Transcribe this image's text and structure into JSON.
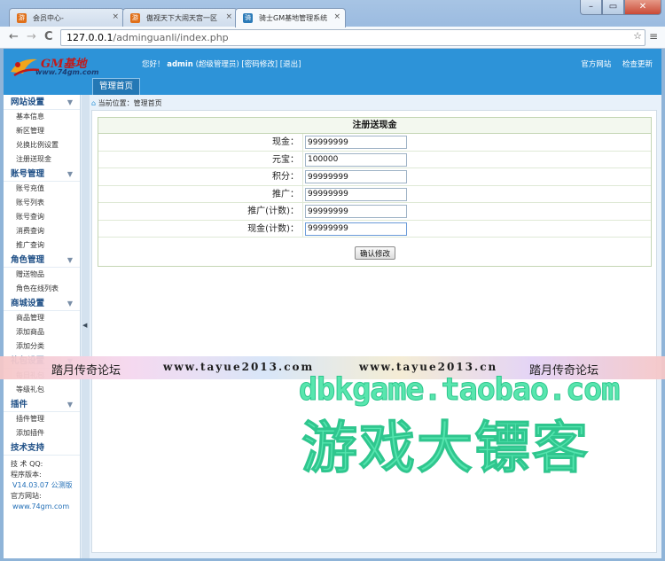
{
  "browser": {
    "tabs": [
      {
        "label": "会员中心-",
        "favicon": "游"
      },
      {
        "label": "傲视天下大闹天宫一区",
        "favicon": "游"
      },
      {
        "label": "骑士GM基地管理系统",
        "favicon": "骑"
      }
    ],
    "close_glyph": "×",
    "url_host": "127.0.0.1",
    "url_path": "/adminguanli/index.php",
    "nav": {
      "back": "←",
      "forward": "→",
      "reload": "C"
    },
    "window_buttons": {
      "minimize": "–",
      "maximize": "▭",
      "close": "✕"
    },
    "extra_icons": "☆",
    "menu": "≡"
  },
  "header": {
    "logo_name": "GM基地",
    "logo_url": "www.74gm.com",
    "greeting": "您好！",
    "username": "admin",
    "role": "(超级管理员)",
    "change_pw": "[密码修改]",
    "logout": "[退出]",
    "link_official": "官方网站",
    "link_check_update": "检查更新",
    "home_tab": "管理首页",
    "accent": "#2d93d8"
  },
  "breadcrumb": {
    "label": "当前位置：管理首页"
  },
  "sidebar": {
    "sections": [
      {
        "title": "网站设置",
        "items": [
          "基本信息",
          "新区管理",
          "兑换比例设置",
          "注册送现金"
        ]
      },
      {
        "title": "账号管理",
        "items": [
          "账号充值",
          "账号列表",
          "账号查询",
          "消费查询",
          "推广查询"
        ]
      },
      {
        "title": "角色管理",
        "items": [
          "赠送物品",
          "角色在线列表"
        ]
      },
      {
        "title": "商城设置",
        "items": [
          "商品管理",
          "添加商品",
          "添加分类"
        ]
      },
      {
        "title": "礼包设置",
        "items": [
          "每日礼包",
          "等级礼包"
        ]
      },
      {
        "title": "插件",
        "items": [
          "插件管理",
          "添加插件"
        ]
      },
      {
        "title": "技术支持",
        "items": []
      }
    ],
    "tech": {
      "qq": "技 术 QQ:",
      "version_label": "程序版本:",
      "version": "V14.03.07 公测版",
      "site_label": "官方网站:",
      "site": "www.74gm.com"
    },
    "chevron": "▼",
    "collapse": "◀"
  },
  "form": {
    "title": "注册送现金",
    "fields": [
      {
        "label": "现金：",
        "value": "99999999"
      },
      {
        "label": "元宝：",
        "value": "100000"
      },
      {
        "label": "积分：",
        "value": "99999999"
      },
      {
        "label": "推广：",
        "value": "99999999"
      },
      {
        "label": "推广(计数)：",
        "value": "99999999"
      },
      {
        "label": "现金(计数)：",
        "value": "99999999"
      }
    ],
    "submit": "确认修改"
  },
  "watermark": {
    "band_left": "踏月传奇论坛",
    "band_url1": "www.tayue2013.com",
    "band_url2": "www.tayue2013.cn",
    "band_right": "踏月传奇论坛",
    "shop_url": "dbkgame.taobao.com",
    "shop_name": "游戏大镖客"
  }
}
